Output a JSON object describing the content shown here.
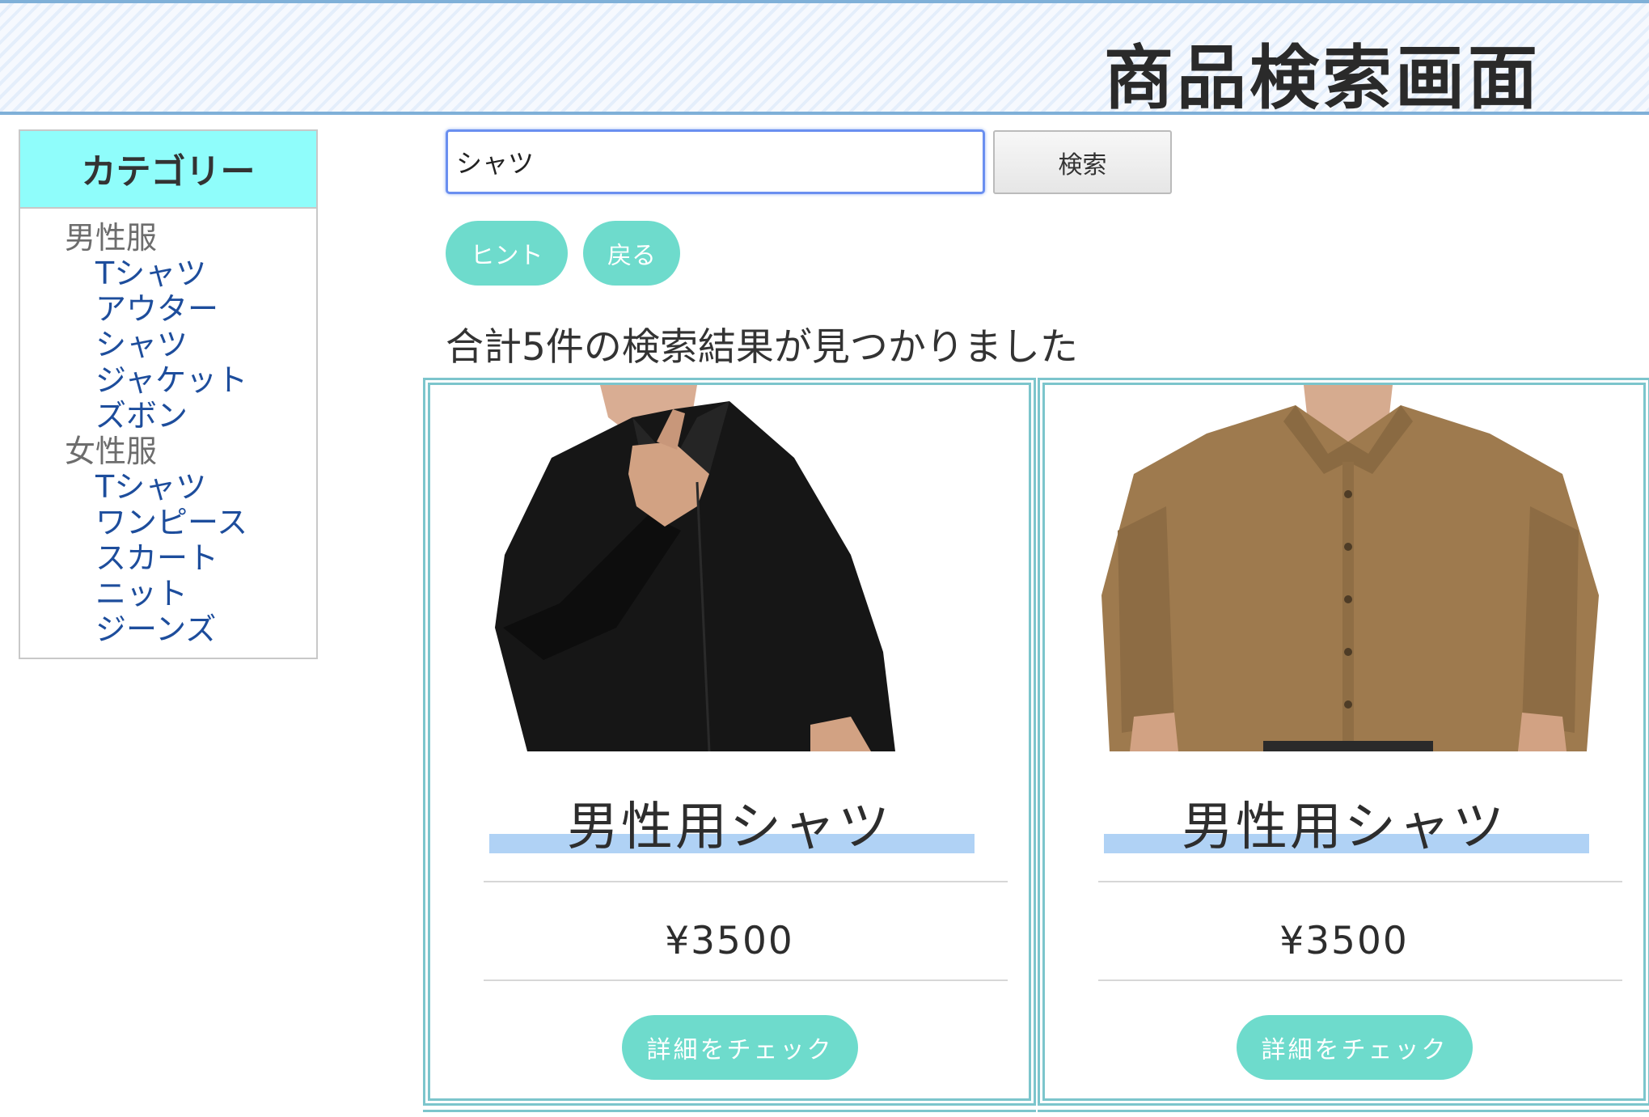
{
  "header": {
    "title": "商品検索画面"
  },
  "sidebar": {
    "heading": "カテゴリー",
    "groups": [
      {
        "label": "男性服",
        "items": [
          "Tシャツ",
          "アウター",
          "シャツ",
          "ジャケット",
          "ズボン"
        ]
      },
      {
        "label": "女性服",
        "items": [
          "Tシャツ",
          "ワンピース",
          "スカート",
          "ニット",
          "ジーンズ"
        ]
      }
    ]
  },
  "search": {
    "value": "シャツ",
    "button_label": "検索"
  },
  "actions": {
    "hint_label": "ヒント",
    "back_label": "戻る"
  },
  "results": {
    "summary": "合計5件の検索結果が見つかりました",
    "products": [
      {
        "name": "男性用シャツ",
        "price": "¥3500",
        "detail_label": "詳細をチェック",
        "image": "black-shirt-photo",
        "shirt_color": "#161616"
      },
      {
        "name": "男性用シャツ",
        "price": "¥3500",
        "detail_label": "詳細をチェック",
        "image": "brown-shirt-photo",
        "shirt_color": "#9e7a4e"
      }
    ]
  },
  "colors": {
    "accent": "#6edbcc",
    "card_border": "#7cc5cc",
    "category_header": "#8ffdfb",
    "link": "#1d4d9c"
  }
}
